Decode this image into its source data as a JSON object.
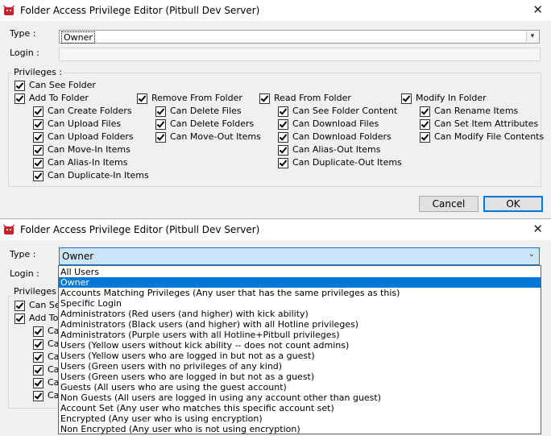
{
  "window_title": "Folder Access Privilege Editor (Pitbull Dev Server)",
  "type_label": "Type :",
  "login_label": "Login :",
  "type_value": "Owner",
  "login_value": "",
  "privileges_label": "Privileges :",
  "can_see_folder": "Can See Folder",
  "columns": [
    {
      "header": "Add To Folder",
      "items": [
        "Can Create Folders",
        "Can Upload Files",
        "Can Upload Folders",
        "Can Move-In Items",
        "Can Alias-In Items",
        "Can Duplicate-In Items"
      ]
    },
    {
      "header": "Remove From Folder",
      "items": [
        "Can Delete Files",
        "Can Delete Folders",
        "Can Move-Out Items"
      ]
    },
    {
      "header": "Read From Folder",
      "items": [
        "Can See Folder Content",
        "Can Download Files",
        "Can Download Folders",
        "Can Alias-Out Items",
        "Can Duplicate-Out Items"
      ]
    },
    {
      "header": "Modify In Folder",
      "items": [
        "Can Rename Items",
        "Can Set Item Attributes",
        "Can Modify File Contents"
      ]
    }
  ],
  "cancel_label": "Cancel",
  "ok_label": "OK",
  "dropdown_options": [
    "All Users",
    "Owner",
    "Accounts Matching Privileges (Any user that has the same privileges as this)",
    "Specific Login",
    "Administrators (Red users (and higher) with kick ability)",
    "Administrators (Black users (and higher) with all Hotline privileges)",
    "Administrators (Purple users with all Hotline+Pitbull privileges)",
    "Users (Yellow users without kick ability -- does not count admins)",
    "Users (Yellow users who are logged in but not as a guest)",
    "Users (Green users with no privileges of any kind)",
    "Users (Green users who are logged in but not as a guest)",
    "Guests (All users who are using the guest account)",
    "Non Guests (All users are logged in using any account other than guest)",
    "Account Set (Any user who matches this specific account set)",
    "Encrypted (Any user who is using encryption)",
    "Non Encrypted (Any user who is not using encryption)"
  ],
  "selected_option_index": 1,
  "partial_labels_window2": [
    "Can See",
    "Add To",
    "Ca",
    "Ca",
    "Ca",
    "Ca",
    "Ca",
    "Ca"
  ],
  "colors": {
    "accent": "#0078d7",
    "icon": "#c0262c"
  },
  "icons": [
    "app-bull-icon",
    "close-icon",
    "chevron-down-icon",
    "checkmark-icon"
  ]
}
